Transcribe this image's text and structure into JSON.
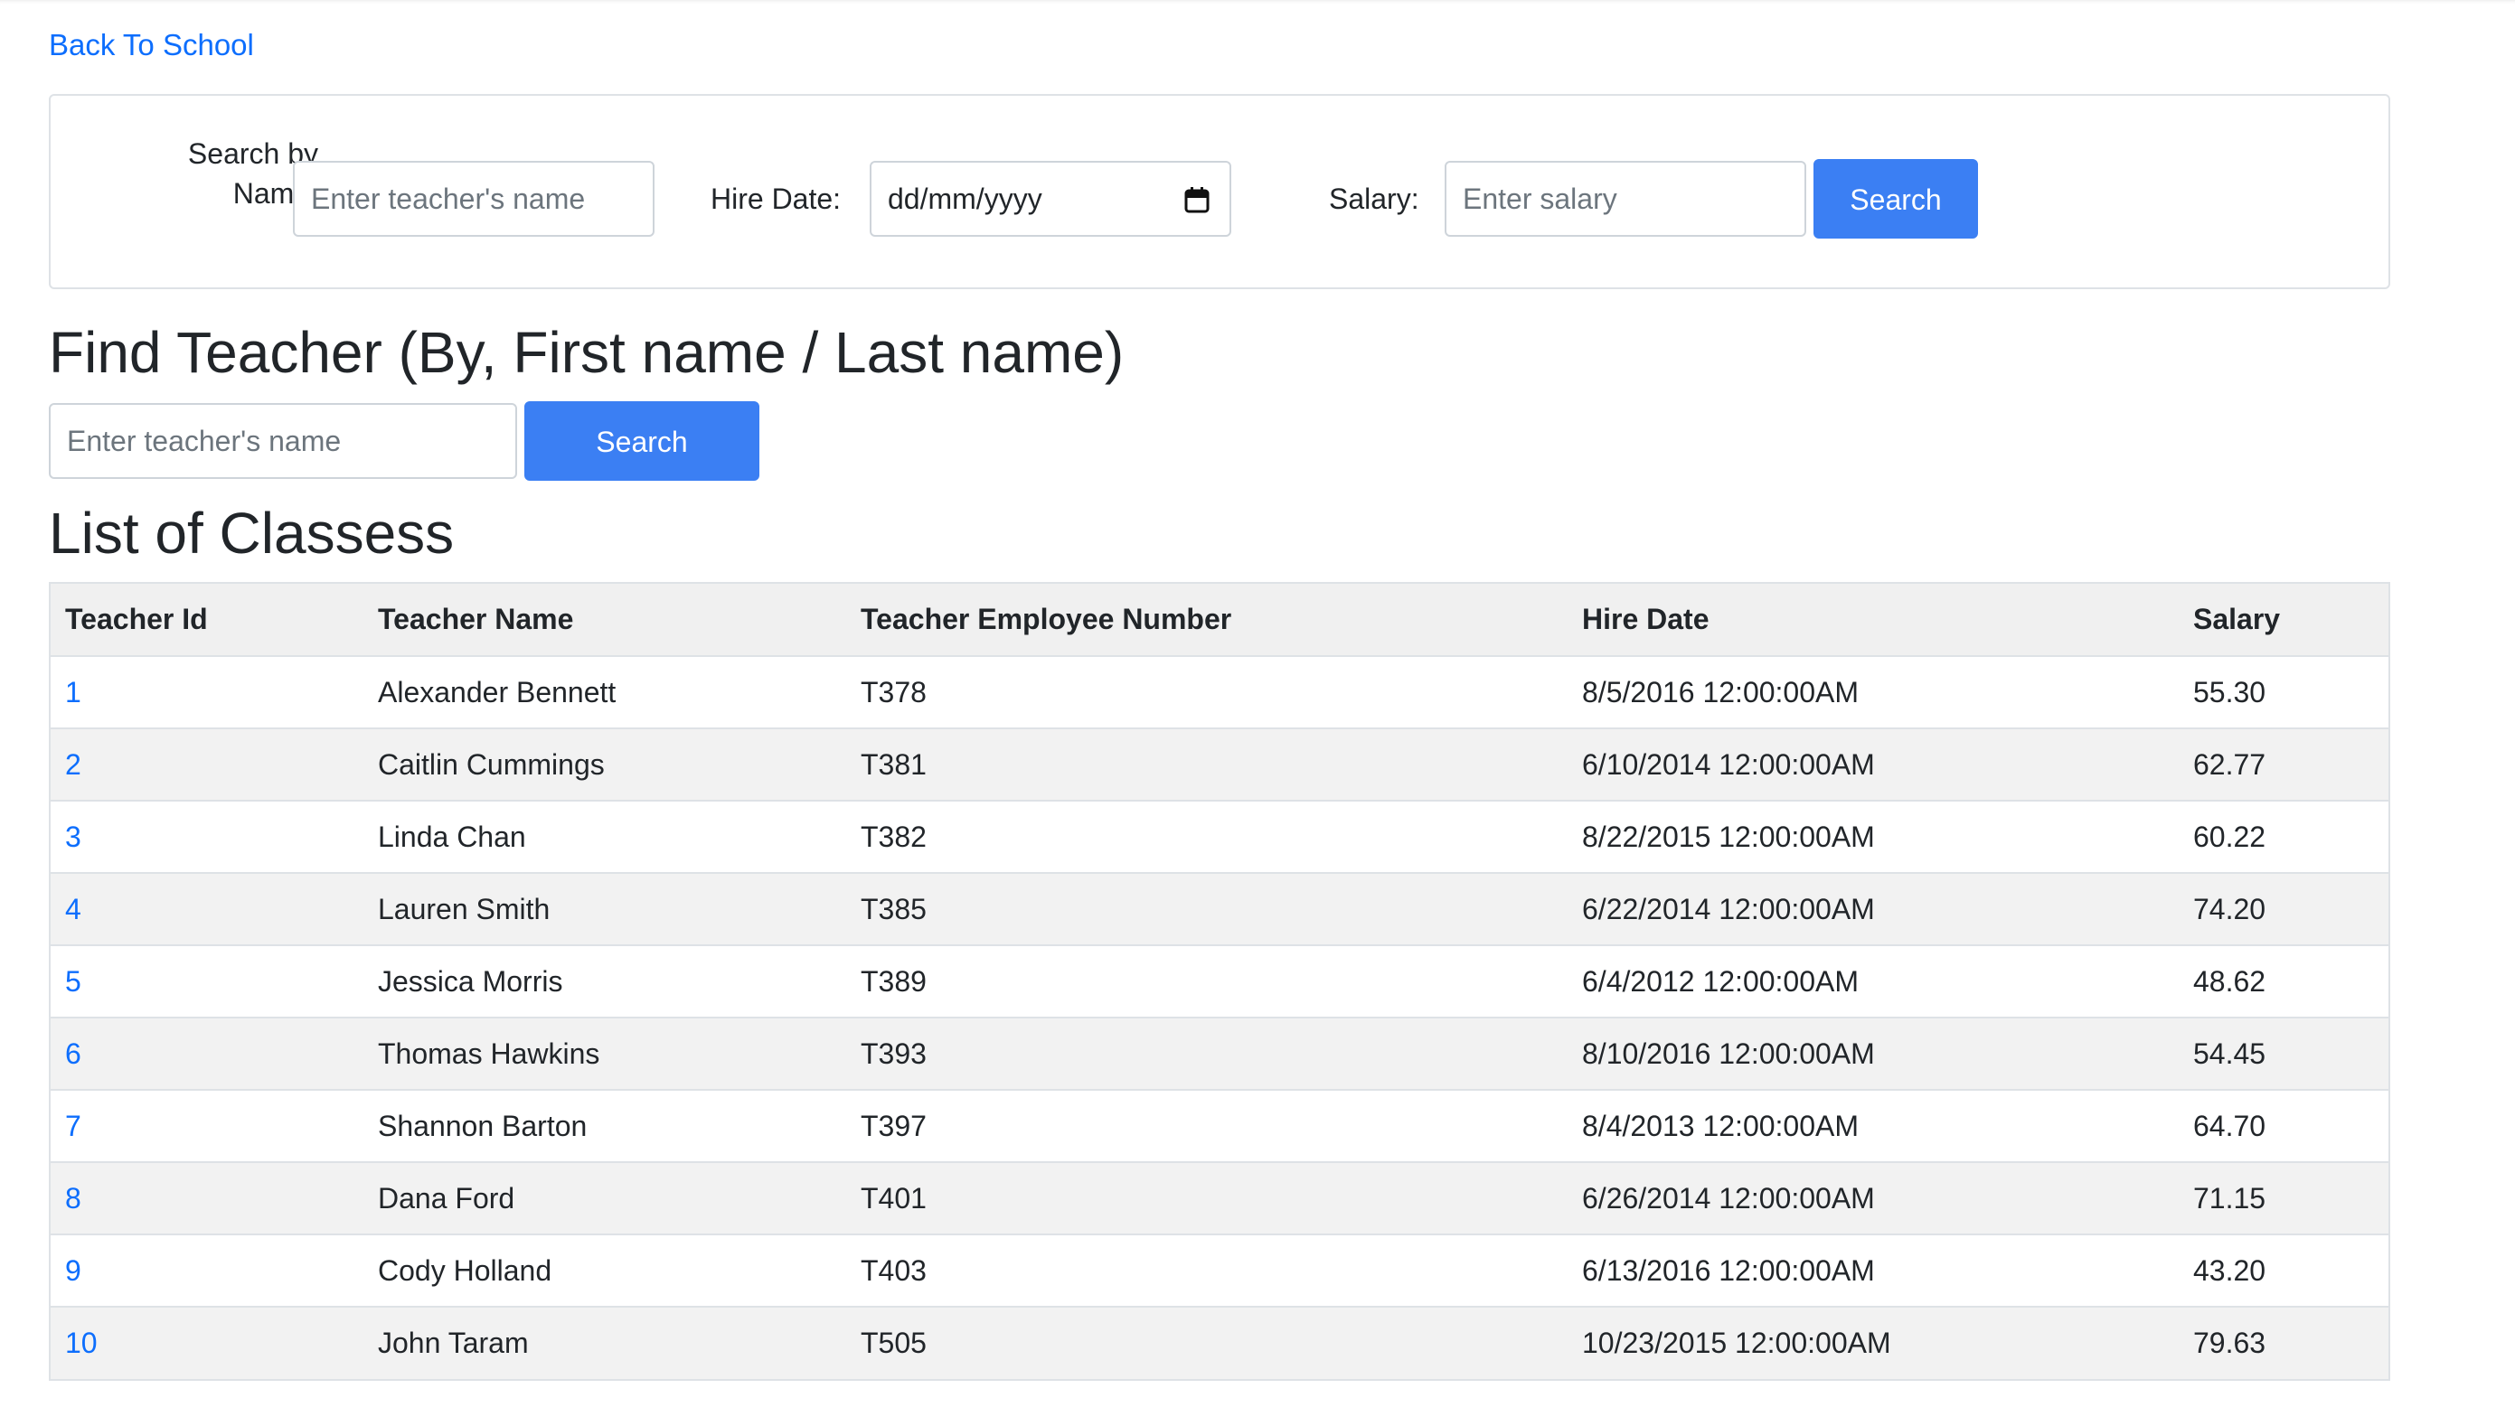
{
  "nav": {
    "back_label": "Back To School"
  },
  "filter": {
    "name_label_line1": "Search by",
    "name_label_line2": "Name:",
    "name_placeholder": "Enter teacher's name",
    "hire_date_label": "Hire Date:",
    "hire_date_value": "dd/mm/yyyy",
    "salary_label": "Salary:",
    "salary_placeholder": "Enter salary",
    "search_label": "Search"
  },
  "find": {
    "heading": "Find Teacher (By, First name / Last name)",
    "placeholder": "Enter teacher's name",
    "search_label": "Search"
  },
  "list": {
    "heading": "List of Classess",
    "columns": [
      "Teacher Id",
      "Teacher Name",
      "Teacher Employee Number",
      "Hire Date",
      "Salary"
    ],
    "rows": [
      {
        "id": "1",
        "name": "Alexander Bennett",
        "employee_number": "T378",
        "hire_date": "8/5/2016 12:00:00AM",
        "salary": "55.30"
      },
      {
        "id": "2",
        "name": "Caitlin Cummings",
        "employee_number": "T381",
        "hire_date": "6/10/2014 12:00:00AM",
        "salary": "62.77"
      },
      {
        "id": "3",
        "name": "Linda Chan",
        "employee_number": "T382",
        "hire_date": "8/22/2015 12:00:00AM",
        "salary": "60.22"
      },
      {
        "id": "4",
        "name": "Lauren Smith",
        "employee_number": "T385",
        "hire_date": "6/22/2014 12:00:00AM",
        "salary": "74.20"
      },
      {
        "id": "5",
        "name": "Jessica Morris",
        "employee_number": "T389",
        "hire_date": "6/4/2012 12:00:00AM",
        "salary": "48.62"
      },
      {
        "id": "6",
        "name": "Thomas Hawkins",
        "employee_number": "T393",
        "hire_date": "8/10/2016 12:00:00AM",
        "salary": "54.45"
      },
      {
        "id": "7",
        "name": "Shannon Barton",
        "employee_number": "T397",
        "hire_date": "8/4/2013 12:00:00AM",
        "salary": "64.70"
      },
      {
        "id": "8",
        "name": "Dana Ford",
        "employee_number": "T401",
        "hire_date": "6/26/2014 12:00:00AM",
        "salary": "71.15"
      },
      {
        "id": "9",
        "name": "Cody Holland",
        "employee_number": "T403",
        "hire_date": "6/13/2016 12:00:00AM",
        "salary": "43.20"
      },
      {
        "id": "10",
        "name": "John Taram",
        "employee_number": "T505",
        "hire_date": "10/23/2015 12:00:00AM",
        "salary": "79.63"
      }
    ]
  },
  "colors": {
    "link": "#0d6efd",
    "button": "#3b7ff3",
    "row_stripe": "#f2f2f2"
  },
  "icons": {
    "date_picker": "calendar-icon"
  }
}
